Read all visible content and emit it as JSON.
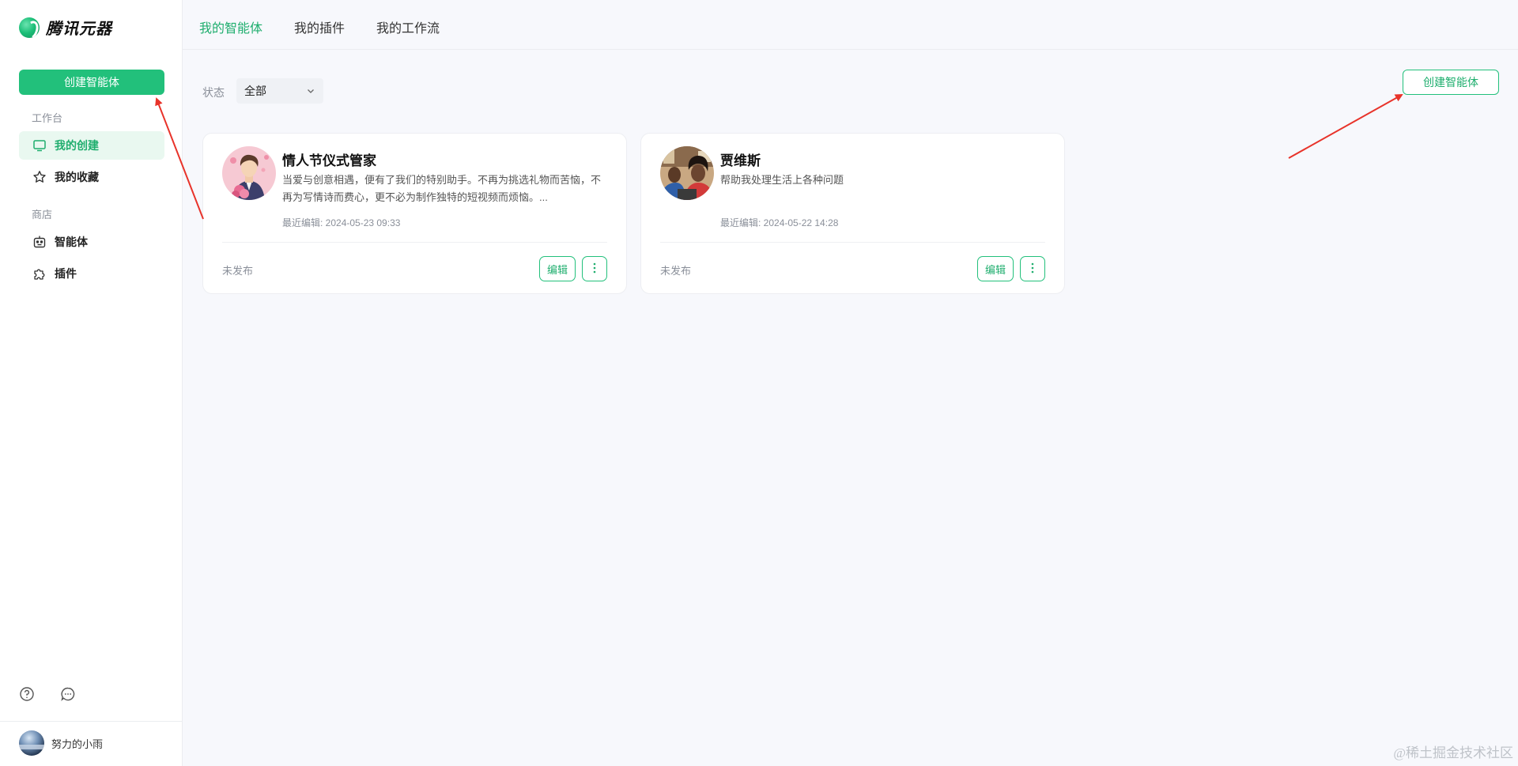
{
  "app": {
    "name": "腾讯元器"
  },
  "sidebar": {
    "create_button": "创建智能体",
    "sections": [
      {
        "label": "工作台",
        "items": [
          {
            "label": "我的创建",
            "icon": "monitor-icon",
            "active": true
          },
          {
            "label": "我的收藏",
            "icon": "star-icon",
            "active": false
          }
        ]
      },
      {
        "label": "商店",
        "items": [
          {
            "label": "智能体",
            "icon": "robot-icon",
            "active": false
          },
          {
            "label": "插件",
            "icon": "puzzle-icon",
            "active": false
          }
        ]
      }
    ],
    "bottom_icons": [
      "help-icon",
      "chat-icon"
    ],
    "user": {
      "name": "努力的小雨"
    }
  },
  "topnav": {
    "tabs": [
      {
        "label": "我的智能体",
        "active": true
      },
      {
        "label": "我的插件",
        "active": false
      },
      {
        "label": "我的工作流",
        "active": false
      }
    ]
  },
  "filter": {
    "label": "状态",
    "value": "全部"
  },
  "main": {
    "create_button": "创建智能体"
  },
  "cards": [
    {
      "title": "情人节仪式管家",
      "description": "当爱与创意相遇，便有了我们的特别助手。不再为挑选礼物而苦恼，不再为写情诗而费心，更不必为制作独特的短视频而烦恼。...",
      "time": "最近编辑: 2024-05-23 09:33",
      "status": "未发布",
      "edit_label": "编辑"
    },
    {
      "title": "贾维斯",
      "description": "帮助我处理生活上各种问题",
      "time": "最近编辑: 2024-05-22 14:28",
      "status": "未发布",
      "edit_label": "编辑"
    }
  ],
  "watermark": "@稀土掘金技术社区",
  "colors": {
    "accent": "#22c07b",
    "accent_text": "#1fae6e",
    "arrow": "#e8332a"
  }
}
